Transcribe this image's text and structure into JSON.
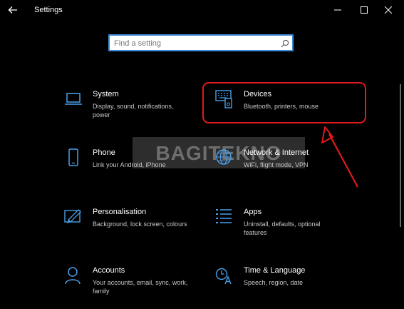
{
  "window": {
    "title": "Settings",
    "back_icon": "back-arrow-icon",
    "minimize_icon": "minimize-icon",
    "maximize_icon": "maximize-icon",
    "close_icon": "close-icon"
  },
  "search": {
    "placeholder": "Find a setting",
    "value": "",
    "icon": "search-icon"
  },
  "categories": [
    {
      "title": "System",
      "description": "Display, sound, notifications, power",
      "icon": "laptop-icon"
    },
    {
      "title": "Devices",
      "description": "Bluetooth, printers, mouse",
      "icon": "keyboard-speaker-icon"
    },
    {
      "title": "Phone",
      "description": "Link your Android, iPhone",
      "icon": "phone-icon"
    },
    {
      "title": "Network & Internet",
      "description": "WiFi, flight mode, VPN",
      "icon": "globe-icon"
    },
    {
      "title": "Personalisation",
      "description": "Background, lock screen, colours",
      "icon": "paintbrush-icon"
    },
    {
      "title": "Apps",
      "description": "Uninstall, defaults, optional features",
      "icon": "apps-list-icon"
    },
    {
      "title": "Accounts",
      "description": "Your accounts, email, sync, work, family",
      "icon": "person-icon"
    },
    {
      "title": "Time & Language",
      "description": "Speech, region, date",
      "icon": "time-language-icon"
    }
  ],
  "annotation": {
    "watermark": "BAGITEKNO",
    "highlight_color": "#e01b1b",
    "highlighted_item": "Devices"
  },
  "colors": {
    "background": "#000000",
    "accent": "#3a88d6",
    "icon": "#4a9fe8",
    "text": "#ffffff",
    "description": "#c8c8c8",
    "annotation": "#e01b1b"
  }
}
